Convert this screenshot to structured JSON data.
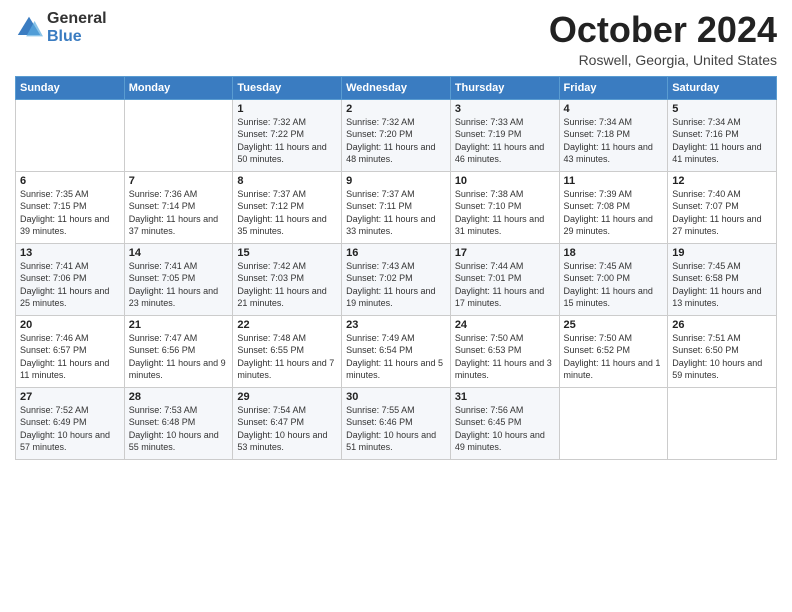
{
  "logo": {
    "general": "General",
    "blue": "Blue"
  },
  "header": {
    "month": "October 2024",
    "location": "Roswell, Georgia, United States"
  },
  "weekdays": [
    "Sunday",
    "Monday",
    "Tuesday",
    "Wednesday",
    "Thursday",
    "Friday",
    "Saturday"
  ],
  "weeks": [
    [
      {
        "day": "",
        "sunrise": "",
        "sunset": "",
        "daylight": ""
      },
      {
        "day": "",
        "sunrise": "",
        "sunset": "",
        "daylight": ""
      },
      {
        "day": "1",
        "sunrise": "Sunrise: 7:32 AM",
        "sunset": "Sunset: 7:22 PM",
        "daylight": "Daylight: 11 hours and 50 minutes."
      },
      {
        "day": "2",
        "sunrise": "Sunrise: 7:32 AM",
        "sunset": "Sunset: 7:20 PM",
        "daylight": "Daylight: 11 hours and 48 minutes."
      },
      {
        "day": "3",
        "sunrise": "Sunrise: 7:33 AM",
        "sunset": "Sunset: 7:19 PM",
        "daylight": "Daylight: 11 hours and 46 minutes."
      },
      {
        "day": "4",
        "sunrise": "Sunrise: 7:34 AM",
        "sunset": "Sunset: 7:18 PM",
        "daylight": "Daylight: 11 hours and 43 minutes."
      },
      {
        "day": "5",
        "sunrise": "Sunrise: 7:34 AM",
        "sunset": "Sunset: 7:16 PM",
        "daylight": "Daylight: 11 hours and 41 minutes."
      }
    ],
    [
      {
        "day": "6",
        "sunrise": "Sunrise: 7:35 AM",
        "sunset": "Sunset: 7:15 PM",
        "daylight": "Daylight: 11 hours and 39 minutes."
      },
      {
        "day": "7",
        "sunrise": "Sunrise: 7:36 AM",
        "sunset": "Sunset: 7:14 PM",
        "daylight": "Daylight: 11 hours and 37 minutes."
      },
      {
        "day": "8",
        "sunrise": "Sunrise: 7:37 AM",
        "sunset": "Sunset: 7:12 PM",
        "daylight": "Daylight: 11 hours and 35 minutes."
      },
      {
        "day": "9",
        "sunrise": "Sunrise: 7:37 AM",
        "sunset": "Sunset: 7:11 PM",
        "daylight": "Daylight: 11 hours and 33 minutes."
      },
      {
        "day": "10",
        "sunrise": "Sunrise: 7:38 AM",
        "sunset": "Sunset: 7:10 PM",
        "daylight": "Daylight: 11 hours and 31 minutes."
      },
      {
        "day": "11",
        "sunrise": "Sunrise: 7:39 AM",
        "sunset": "Sunset: 7:08 PM",
        "daylight": "Daylight: 11 hours and 29 minutes."
      },
      {
        "day": "12",
        "sunrise": "Sunrise: 7:40 AM",
        "sunset": "Sunset: 7:07 PM",
        "daylight": "Daylight: 11 hours and 27 minutes."
      }
    ],
    [
      {
        "day": "13",
        "sunrise": "Sunrise: 7:41 AM",
        "sunset": "Sunset: 7:06 PM",
        "daylight": "Daylight: 11 hours and 25 minutes."
      },
      {
        "day": "14",
        "sunrise": "Sunrise: 7:41 AM",
        "sunset": "Sunset: 7:05 PM",
        "daylight": "Daylight: 11 hours and 23 minutes."
      },
      {
        "day": "15",
        "sunrise": "Sunrise: 7:42 AM",
        "sunset": "Sunset: 7:03 PM",
        "daylight": "Daylight: 11 hours and 21 minutes."
      },
      {
        "day": "16",
        "sunrise": "Sunrise: 7:43 AM",
        "sunset": "Sunset: 7:02 PM",
        "daylight": "Daylight: 11 hours and 19 minutes."
      },
      {
        "day": "17",
        "sunrise": "Sunrise: 7:44 AM",
        "sunset": "Sunset: 7:01 PM",
        "daylight": "Daylight: 11 hours and 17 minutes."
      },
      {
        "day": "18",
        "sunrise": "Sunrise: 7:45 AM",
        "sunset": "Sunset: 7:00 PM",
        "daylight": "Daylight: 11 hours and 15 minutes."
      },
      {
        "day": "19",
        "sunrise": "Sunrise: 7:45 AM",
        "sunset": "Sunset: 6:58 PM",
        "daylight": "Daylight: 11 hours and 13 minutes."
      }
    ],
    [
      {
        "day": "20",
        "sunrise": "Sunrise: 7:46 AM",
        "sunset": "Sunset: 6:57 PM",
        "daylight": "Daylight: 11 hours and 11 minutes."
      },
      {
        "day": "21",
        "sunrise": "Sunrise: 7:47 AM",
        "sunset": "Sunset: 6:56 PM",
        "daylight": "Daylight: 11 hours and 9 minutes."
      },
      {
        "day": "22",
        "sunrise": "Sunrise: 7:48 AM",
        "sunset": "Sunset: 6:55 PM",
        "daylight": "Daylight: 11 hours and 7 minutes."
      },
      {
        "day": "23",
        "sunrise": "Sunrise: 7:49 AM",
        "sunset": "Sunset: 6:54 PM",
        "daylight": "Daylight: 11 hours and 5 minutes."
      },
      {
        "day": "24",
        "sunrise": "Sunrise: 7:50 AM",
        "sunset": "Sunset: 6:53 PM",
        "daylight": "Daylight: 11 hours and 3 minutes."
      },
      {
        "day": "25",
        "sunrise": "Sunrise: 7:50 AM",
        "sunset": "Sunset: 6:52 PM",
        "daylight": "Daylight: 11 hours and 1 minute."
      },
      {
        "day": "26",
        "sunrise": "Sunrise: 7:51 AM",
        "sunset": "Sunset: 6:50 PM",
        "daylight": "Daylight: 10 hours and 59 minutes."
      }
    ],
    [
      {
        "day": "27",
        "sunrise": "Sunrise: 7:52 AM",
        "sunset": "Sunset: 6:49 PM",
        "daylight": "Daylight: 10 hours and 57 minutes."
      },
      {
        "day": "28",
        "sunrise": "Sunrise: 7:53 AM",
        "sunset": "Sunset: 6:48 PM",
        "daylight": "Daylight: 10 hours and 55 minutes."
      },
      {
        "day": "29",
        "sunrise": "Sunrise: 7:54 AM",
        "sunset": "Sunset: 6:47 PM",
        "daylight": "Daylight: 10 hours and 53 minutes."
      },
      {
        "day": "30",
        "sunrise": "Sunrise: 7:55 AM",
        "sunset": "Sunset: 6:46 PM",
        "daylight": "Daylight: 10 hours and 51 minutes."
      },
      {
        "day": "31",
        "sunrise": "Sunrise: 7:56 AM",
        "sunset": "Sunset: 6:45 PM",
        "daylight": "Daylight: 10 hours and 49 minutes."
      },
      {
        "day": "",
        "sunrise": "",
        "sunset": "",
        "daylight": ""
      },
      {
        "day": "",
        "sunrise": "",
        "sunset": "",
        "daylight": ""
      }
    ]
  ]
}
